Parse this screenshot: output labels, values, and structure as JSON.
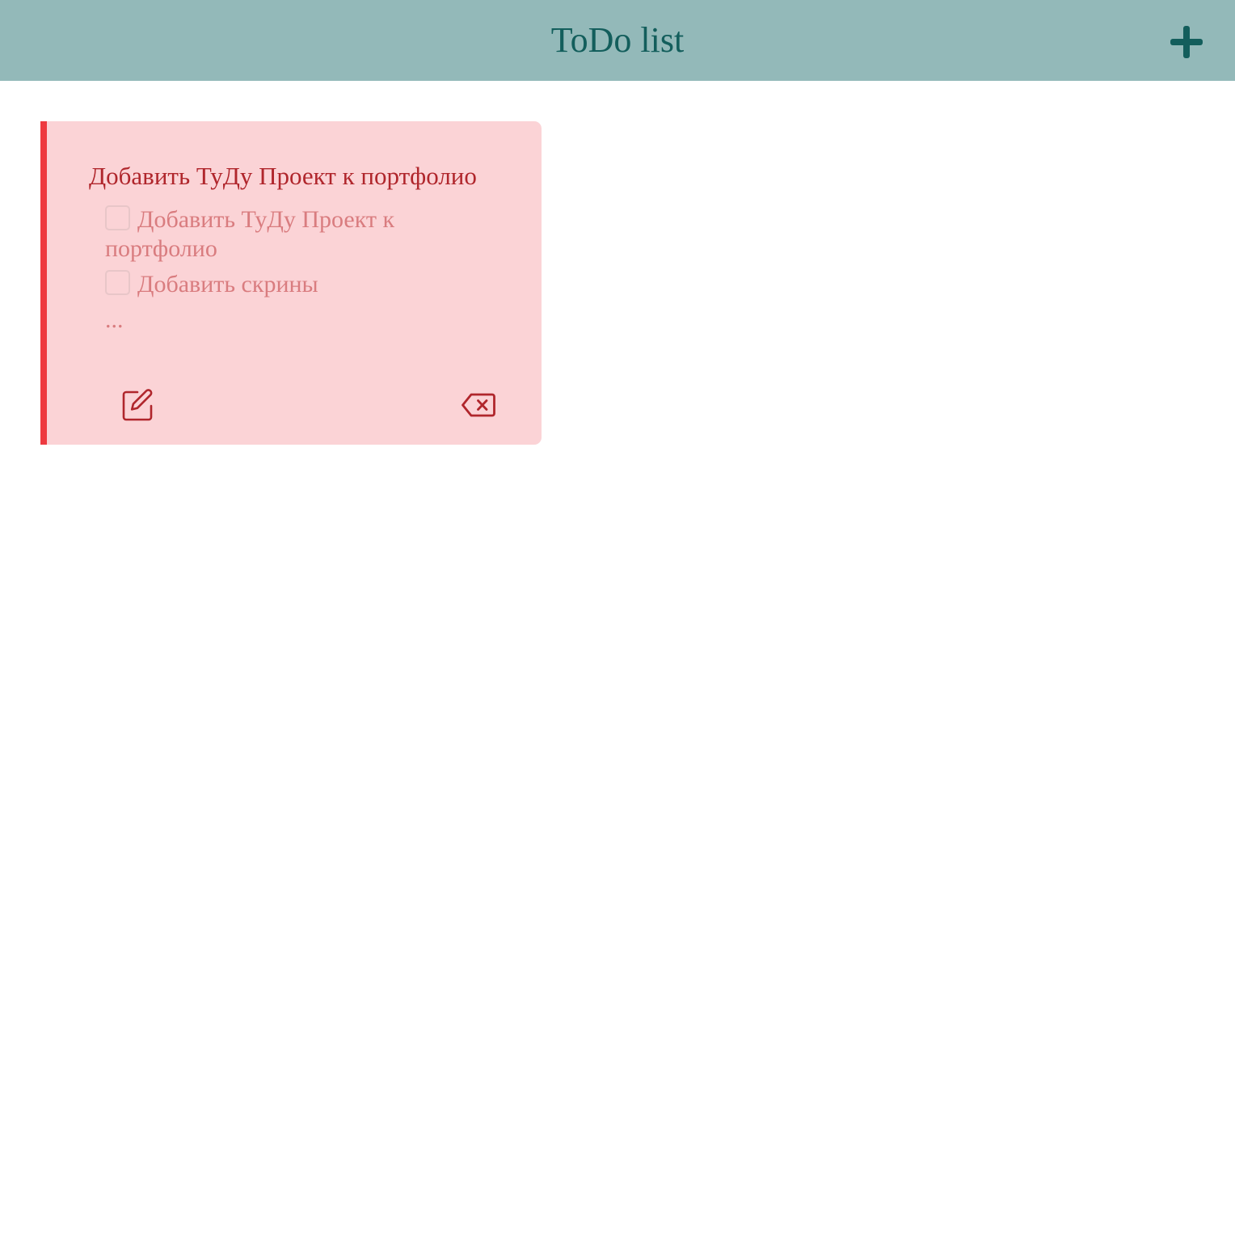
{
  "header": {
    "title": "ToDo list",
    "add_icon": "plus-icon",
    "background_color": "#93b9b9",
    "accent_color": "#135e5c"
  },
  "cards": [
    {
      "title": "Добавить ТуДу Проект к портфолио",
      "tasks": [
        {
          "label": "Добавить ТуДу Проект к портфолио",
          "checked": false
        },
        {
          "label": "Добавить скрины",
          "checked": false
        }
      ],
      "more": "...",
      "edit_icon": "pencil-square-icon",
      "delete_icon": "backspace-icon",
      "background_color": "#fbd3d6",
      "accent_color": "#ee3a40",
      "text_color": "#b0262c"
    }
  ]
}
